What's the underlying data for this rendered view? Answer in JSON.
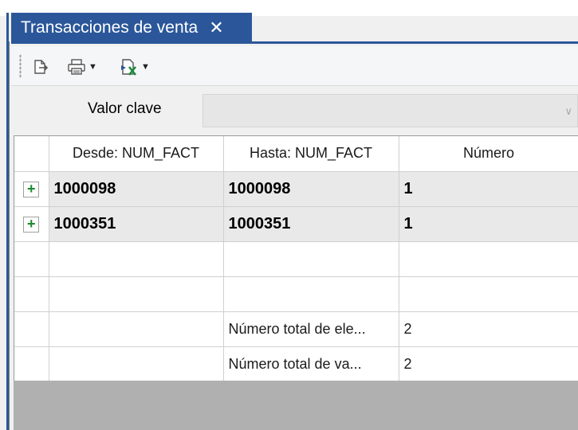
{
  "tab": {
    "title": "Transacciones de venta",
    "close_glyph": "✕"
  },
  "toolbar": {
    "buttons": [
      {
        "icon": "export-icon"
      },
      {
        "icon": "print-icon",
        "dropdown": true
      },
      {
        "icon": "excel-export-icon",
        "dropdown": true
      }
    ],
    "dropdown_glyph": "▼"
  },
  "key": {
    "label": "Valor clave",
    "value": "",
    "chevron": "∨"
  },
  "grid": {
    "columns": [
      "",
      "Desde: NUM_FACT",
      "Hasta: NUM_FACT",
      "Número"
    ],
    "rows": [
      {
        "expand": "+",
        "desde": "1000098",
        "hasta": "1000098",
        "numero": "1"
      },
      {
        "expand": "+",
        "desde": "1000351",
        "hasta": "1000351",
        "numero": "1"
      }
    ],
    "summary": [
      {
        "label": "Número total de ele...",
        "value": "2"
      },
      {
        "label": "Número total de va...",
        "value": "2"
      }
    ]
  },
  "colors": {
    "accent": "#2b579a",
    "expand_plus": "#1a8a2a",
    "footer": "#b0b0b0"
  }
}
